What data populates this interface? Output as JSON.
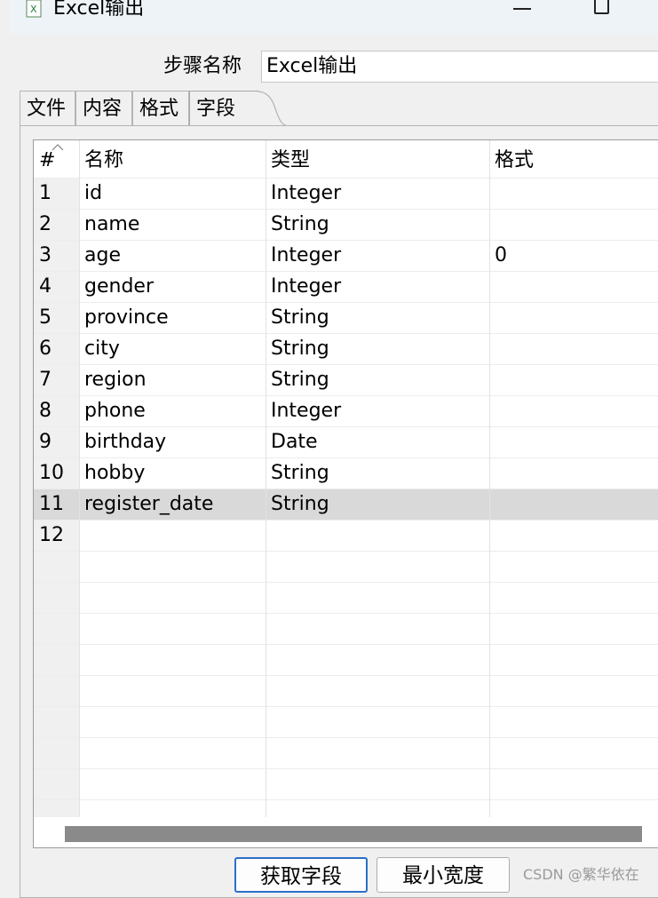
{
  "window": {
    "title": "Excel输出"
  },
  "step": {
    "label": "步骤名称",
    "value": "Excel输出"
  },
  "tabs": [
    {
      "label": "文件"
    },
    {
      "label": "内容"
    },
    {
      "label": "格式"
    },
    {
      "label": "字段"
    }
  ],
  "active_tab": "字段",
  "table": {
    "headers": {
      "num": "#",
      "name": "名称",
      "type": "类型",
      "format": "格式"
    },
    "rows": [
      {
        "num": "1",
        "name": "id",
        "type": "Integer",
        "format": ""
      },
      {
        "num": "2",
        "name": "name",
        "type": "String",
        "format": ""
      },
      {
        "num": "3",
        "name": "age",
        "type": "Integer",
        "format": "0"
      },
      {
        "num": "4",
        "name": "gender",
        "type": "Integer",
        "format": ""
      },
      {
        "num": "5",
        "name": "province",
        "type": "String",
        "format": ""
      },
      {
        "num": "6",
        "name": "city",
        "type": "String",
        "format": ""
      },
      {
        "num": "7",
        "name": "region",
        "type": "String",
        "format": ""
      },
      {
        "num": "8",
        "name": "phone",
        "type": "Integer",
        "format": ""
      },
      {
        "num": "9",
        "name": "birthday",
        "type": "Date",
        "format": ""
      },
      {
        "num": "10",
        "name": "hobby",
        "type": "String",
        "format": ""
      },
      {
        "num": "11",
        "name": "register_date",
        "type": "String",
        "format": ""
      },
      {
        "num": "12",
        "name": "",
        "type": "",
        "format": ""
      }
    ],
    "selected_row": "11"
  },
  "buttons": {
    "get_fields": "获取字段",
    "min_width": "最小宽度"
  },
  "watermark": "CSDN @繁华依在",
  "colors": {
    "selected_row": "#d9d9d9",
    "focus_border": "#2a6fc9",
    "scroll_thumb": "#8a8a8a"
  }
}
